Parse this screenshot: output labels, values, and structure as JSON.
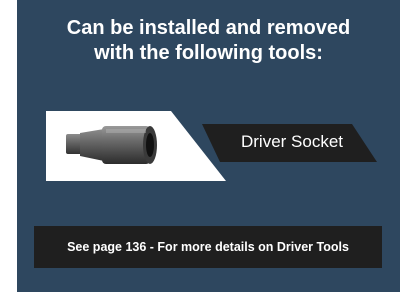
{
  "heading": {
    "line1": "Can be installed and removed",
    "line2": "with the following tools:"
  },
  "tool": {
    "name": "Driver Socket",
    "icon": "driver-socket-icon"
  },
  "footer": {
    "text": "See page 136 - For more details on Driver Tools"
  },
  "colors": {
    "panel": "#2e475f",
    "banner": "#1f1f1f",
    "text": "#ffffff"
  }
}
